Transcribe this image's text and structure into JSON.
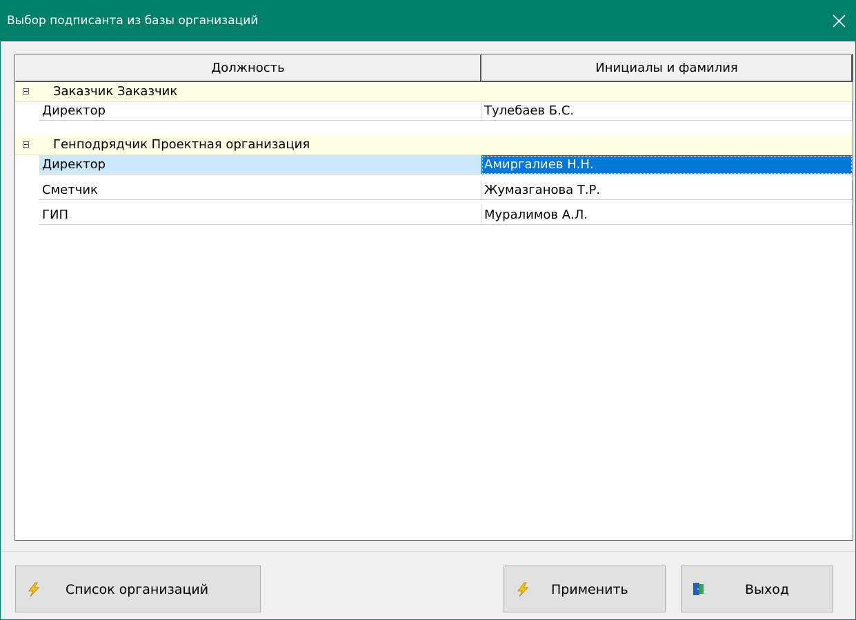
{
  "window": {
    "title": "Выбор подписанта из базы организаций"
  },
  "grid": {
    "columns": [
      "Должность",
      "Инициалы и фамилия"
    ],
    "groups": [
      {
        "label": "Заказчик Заказчик",
        "rows": [
          {
            "position": "Директор",
            "name": "Тулебаев Б.С."
          }
        ]
      },
      {
        "label": "Генподрядчик Проектная организация",
        "rows": [
          {
            "position": "Директор",
            "name": "Амиргалиев Н.Н.",
            "selected": true
          },
          {
            "position": "Сметчик",
            "name": "Жумазганова Т.Р."
          },
          {
            "position": "ГИП",
            "name": "Муралимов А.Л."
          }
        ]
      }
    ]
  },
  "buttons": {
    "organizations": "Список организаций",
    "apply": "Применить",
    "exit": "Выход"
  },
  "icons": {
    "close": "close-icon",
    "organizations": "lightning-icon",
    "apply": "lightning-icon",
    "exit": "door-exit-icon"
  },
  "colors": {
    "titlebar": "#00806a",
    "group_row": "#ffffe6",
    "selected_cell": "#0078d7",
    "selected_row": "#cce8ff"
  }
}
